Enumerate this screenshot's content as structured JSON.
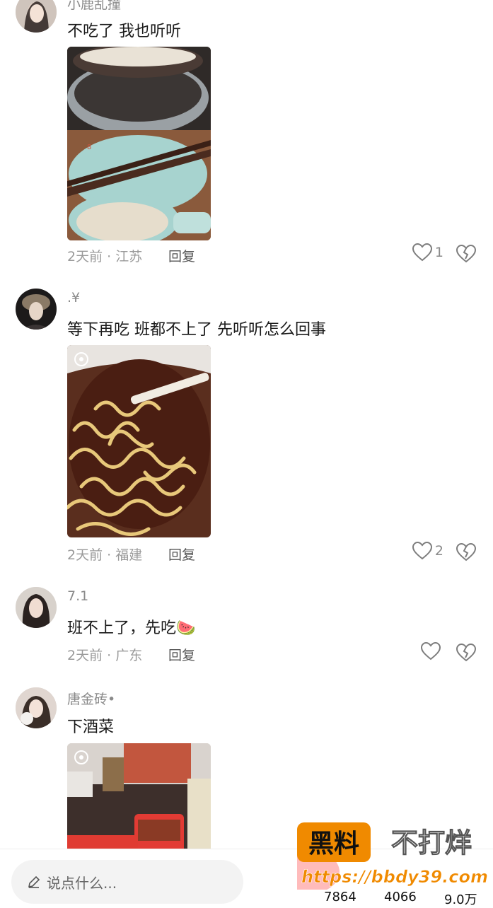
{
  "comments": [
    {
      "username": "小鹿乱撞",
      "text": "不吃了 我也听听",
      "time": "2天前",
      "location": "江苏",
      "reply_label": "回复",
      "likes": "1"
    },
    {
      "username": ".¥",
      "text": "等下再吃 班都不上了 先听听怎么回事",
      "time": "2天前",
      "location": "福建",
      "reply_label": "回复",
      "likes": "2"
    },
    {
      "username": "7.1",
      "text": "班不上了，先吃🍉",
      "time": "2天前",
      "location": "广东",
      "reply_label": "回复",
      "likes": ""
    },
    {
      "username": "唐金砖•",
      "text": "下酒菜",
      "time": "",
      "location": "",
      "reply_label": "",
      "likes": ""
    }
  ],
  "meta_separator": " · ",
  "bottom": {
    "input_placeholder": "说点什么...",
    "stat_1": "7864",
    "stat_2": "4066",
    "stat_3": "9.0万"
  },
  "watermark": {
    "line1_a": "黑料",
    "line1_b": "不打烊",
    "line2": "https://bbdy39.com"
  },
  "colors": {
    "background": "#ffffff",
    "username": "#8a8a8a",
    "meta": "#9a9a9a",
    "watermark_orange": "#f08a00"
  }
}
